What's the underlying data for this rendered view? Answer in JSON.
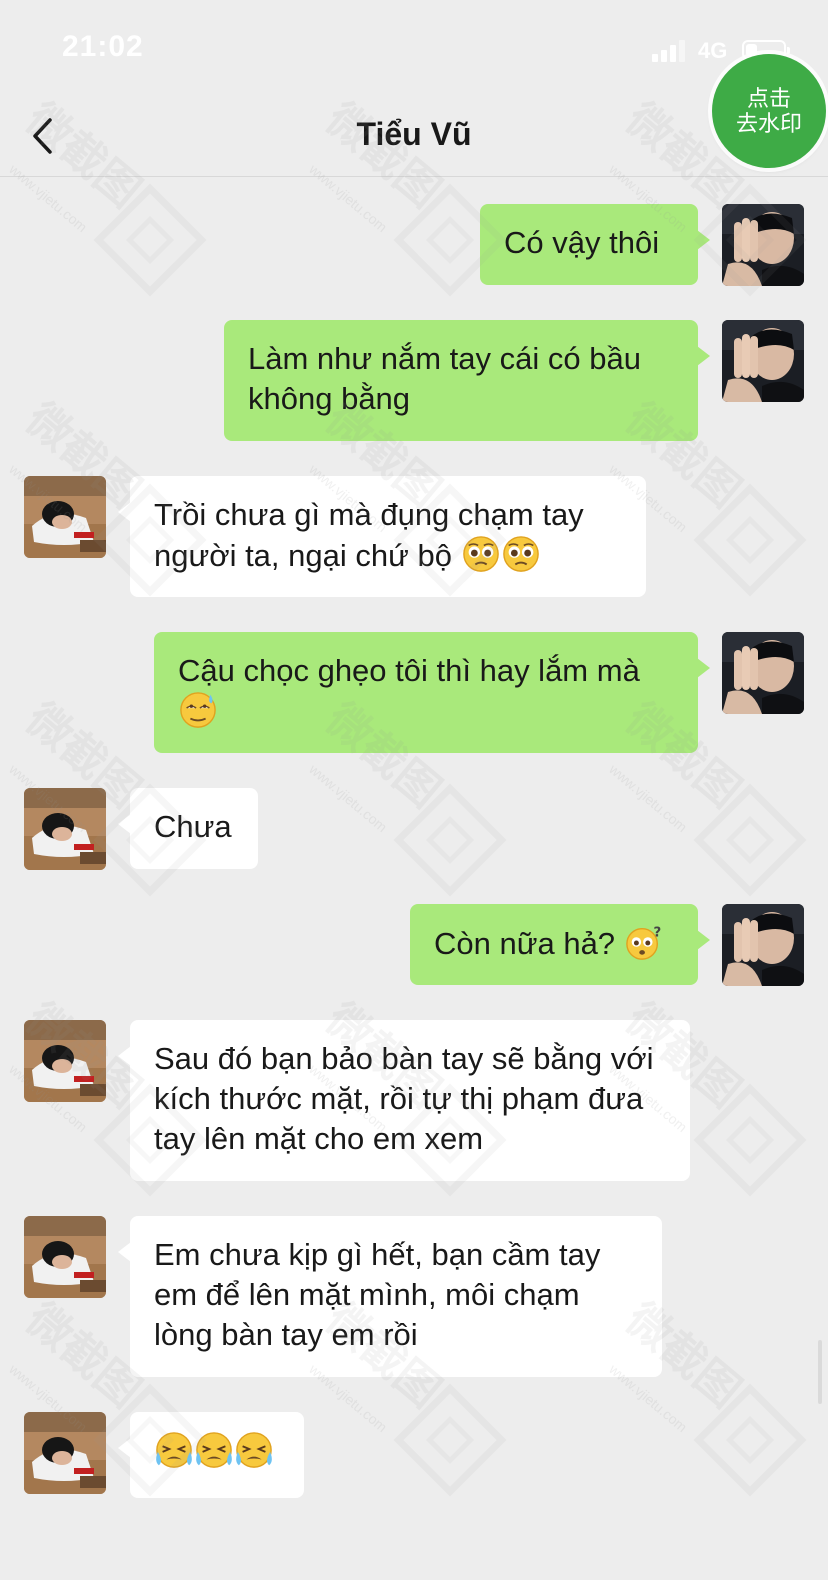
{
  "status_bar": {
    "time": "21:02",
    "network": "4G",
    "battery_level": 0.3
  },
  "header": {
    "title": "Tiểu Vũ"
  },
  "watermark_button": {
    "line1": "点击",
    "line2": "去水印"
  },
  "watermark": {
    "text": "微截图",
    "url": "www.vjietu.com"
  },
  "messages": [
    {
      "sender": "me",
      "text": "Có vậy thôi",
      "emoji": []
    },
    {
      "sender": "me",
      "text": "Làm như nắm tay cái có bầu không bằng",
      "emoji": []
    },
    {
      "sender": "them",
      "text": "Trồi chưa gì mà đụng chạm tay người ta, ngại chứ bộ",
      "emoji": [
        "pleading-face-emoji",
        "pleading-face-emoji"
      ]
    },
    {
      "sender": "me",
      "text": "Cậu chọc ghẹo tôi thì hay lắm mà",
      "emoji": [
        "sweat-smile-rolling-eyes-emoji"
      ]
    },
    {
      "sender": "them",
      "text": "Chưa",
      "emoji": []
    },
    {
      "sender": "me",
      "text": "Còn nữa hả?",
      "emoji": [
        "puzzled-face-emoji"
      ]
    },
    {
      "sender": "them",
      "text": "Sau đó bạn bảo bàn tay sẽ bằng với kích thước mặt, rồi tự thị phạm đưa tay lên mặt cho em xem",
      "emoji": []
    },
    {
      "sender": "them",
      "text": "Em chưa kịp gì hết, bạn cầm tay em để lên mặt mình, môi chạm lòng bàn tay em rồi",
      "emoji": []
    },
    {
      "sender": "them",
      "text": "",
      "emoji": [
        "crying-face-emoji",
        "crying-face-emoji",
        "crying-face-emoji"
      ]
    }
  ],
  "colors": {
    "my_bubble": "#a9e97b",
    "their_bubble": "#ffffff",
    "background": "#ededed",
    "accent": "#3eab46"
  }
}
